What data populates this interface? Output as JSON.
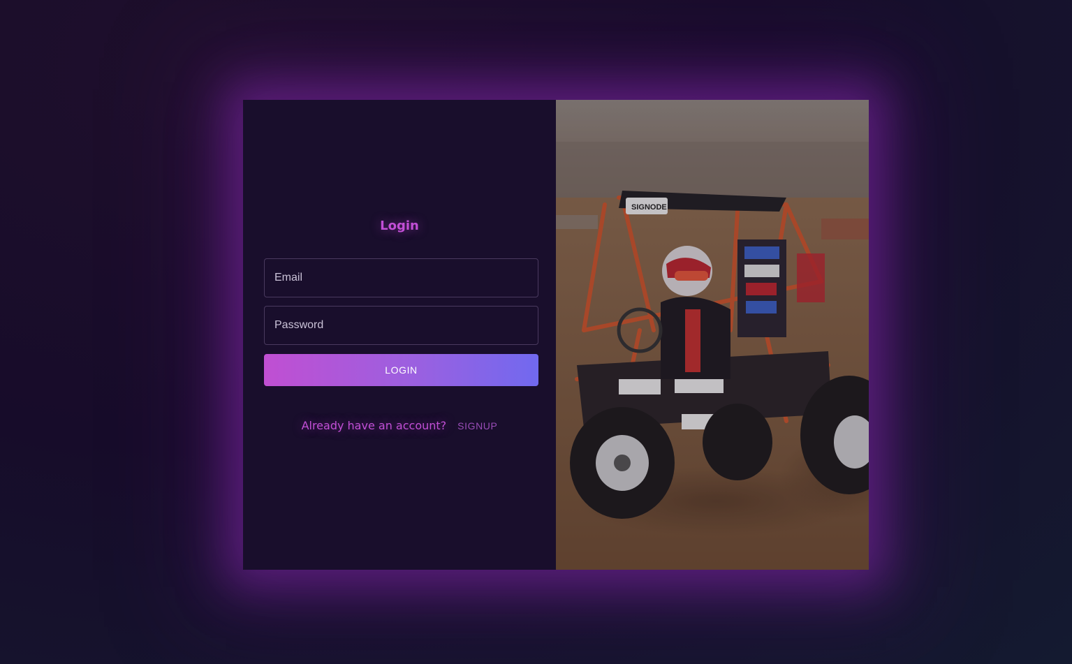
{
  "login_form": {
    "heading": "Login",
    "email_placeholder": "Email",
    "password_placeholder": "Password",
    "login_button_label": "LOGIN",
    "switch_prompt": "Already have an account?",
    "signup_link_label": "SIGNUP"
  },
  "hero_image": {
    "description_icon": "off-road-buggy-photo"
  },
  "colors": {
    "accent": "#c24fd6",
    "button_gradient_start": "#c04fd2",
    "button_gradient_end": "#7169ef",
    "panel_background": "#190e2c",
    "page_background": "#170c2a"
  }
}
